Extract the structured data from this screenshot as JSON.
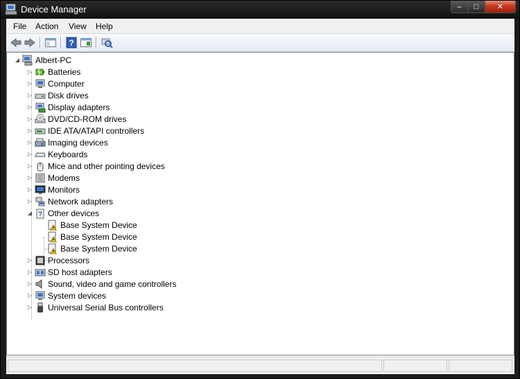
{
  "window": {
    "title": "Device Manager",
    "minimize": "–",
    "maximize": "□",
    "close": "✕"
  },
  "menu": [
    "File",
    "Action",
    "View",
    "Help"
  ],
  "toolbar": [
    "back-icon",
    "forward-icon",
    "show-hide-console-tree-icon",
    "help-icon",
    "properties-pane-icon",
    "scan-hardware-changes-icon"
  ],
  "tree": {
    "root": "Albert-PC",
    "categories": [
      {
        "label": "Batteries",
        "icon": "battery-icon"
      },
      {
        "label": "Computer",
        "icon": "computer-icon"
      },
      {
        "label": "Disk drives",
        "icon": "disk-drive-icon"
      },
      {
        "label": "Display adapters",
        "icon": "display-adapter-icon"
      },
      {
        "label": "DVD/CD-ROM drives",
        "icon": "dvd-drive-icon"
      },
      {
        "label": "IDE ATA/ATAPI controllers",
        "icon": "ide-controller-icon"
      },
      {
        "label": "Imaging devices",
        "icon": "imaging-device-icon"
      },
      {
        "label": "Keyboards",
        "icon": "keyboard-icon"
      },
      {
        "label": "Mice and other pointing devices",
        "icon": "mouse-icon"
      },
      {
        "label": "Modems",
        "icon": "modem-icon"
      },
      {
        "label": "Monitors",
        "icon": "monitor-icon"
      },
      {
        "label": "Network adapters",
        "icon": "network-adapter-icon"
      },
      {
        "label": "Other devices",
        "icon": "other-devices-icon",
        "expanded": true,
        "children": [
          {
            "label": "Base System Device",
            "icon": "warning-device-icon"
          },
          {
            "label": "Base System Device",
            "icon": "warning-device-icon"
          },
          {
            "label": "Base System Device",
            "icon": "warning-device-icon"
          }
        ]
      },
      {
        "label": "Processors",
        "icon": "processor-icon"
      },
      {
        "label": "SD host adapters",
        "icon": "sd-host-icon"
      },
      {
        "label": "Sound, video and game controllers",
        "icon": "sound-icon"
      },
      {
        "label": "System devices",
        "icon": "system-device-icon"
      },
      {
        "label": "Universal Serial Bus controllers",
        "icon": "usb-icon"
      }
    ]
  }
}
